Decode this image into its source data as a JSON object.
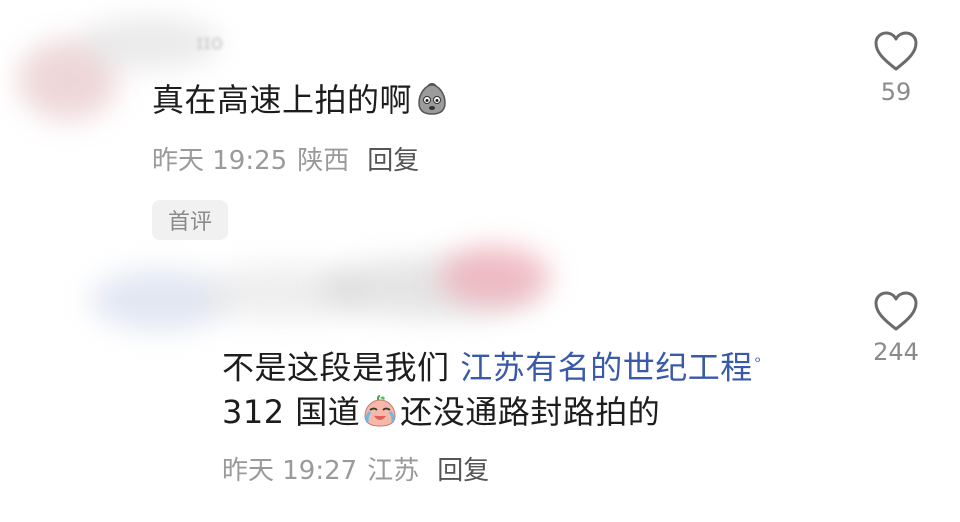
{
  "comments": [
    {
      "username_partial": "ɪɪo",
      "text_before_emoji": "真在高速上拍的啊",
      "emoji": "grimace-emoji",
      "time": "昨天 19:25",
      "location": "陕西",
      "reply_label": "回复",
      "badge": "首评",
      "likes": "59"
    },
    {
      "text_part1": "不是这段是我们 ",
      "link_text": "江苏有名的世纪工程",
      "link_icon": "search-icon",
      "text_part2": " 312 国道",
      "emoji": "crying-laughing-emoji",
      "text_part3": "还没通路封路拍的",
      "time": "昨天 19:27",
      "location": "江苏",
      "reply_label": "回复",
      "likes": "244"
    }
  ],
  "colors": {
    "link": "#3a59a8",
    "meta": "#9a9a9a",
    "text": "#1d1d1d"
  }
}
